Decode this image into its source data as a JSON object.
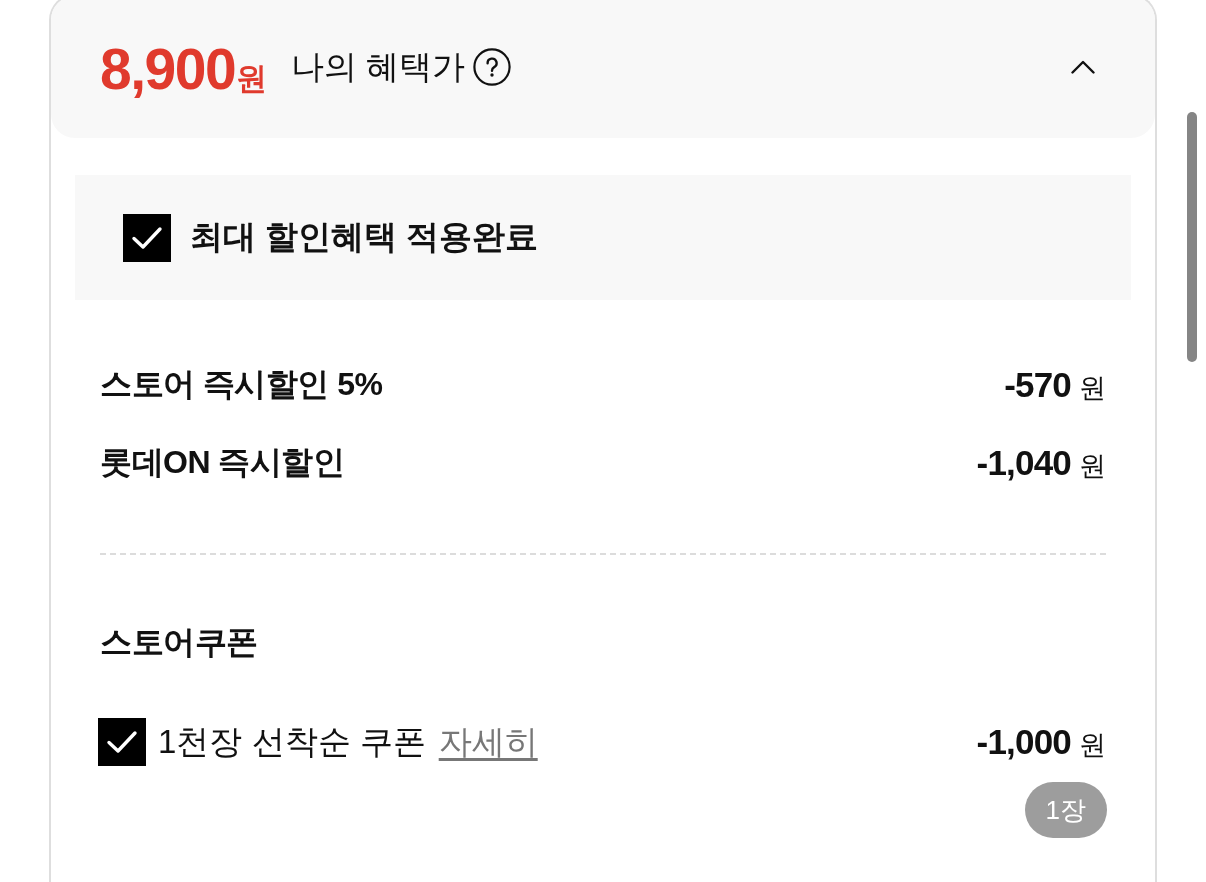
{
  "benefit_price": {
    "amount": "8,900",
    "unit": "원",
    "label": "나의 혜택가",
    "expanded": true
  },
  "max_discount": {
    "label": "최대 할인혜택 적용완료",
    "checked": true
  },
  "discounts": [
    {
      "label": "스토어 즉시할인 5%",
      "amount": "-570",
      "unit": "원"
    },
    {
      "label": "롯데ON 즉시할인",
      "amount": "-1,040",
      "unit": "원"
    }
  ],
  "store_coupon": {
    "title": "스토어쿠폰",
    "coupons": [
      {
        "label": "1천장 선착순 쿠폰",
        "link": "자세히",
        "checked": true,
        "amount": "-1,000",
        "unit": "원",
        "count": "1장"
      }
    ]
  }
}
